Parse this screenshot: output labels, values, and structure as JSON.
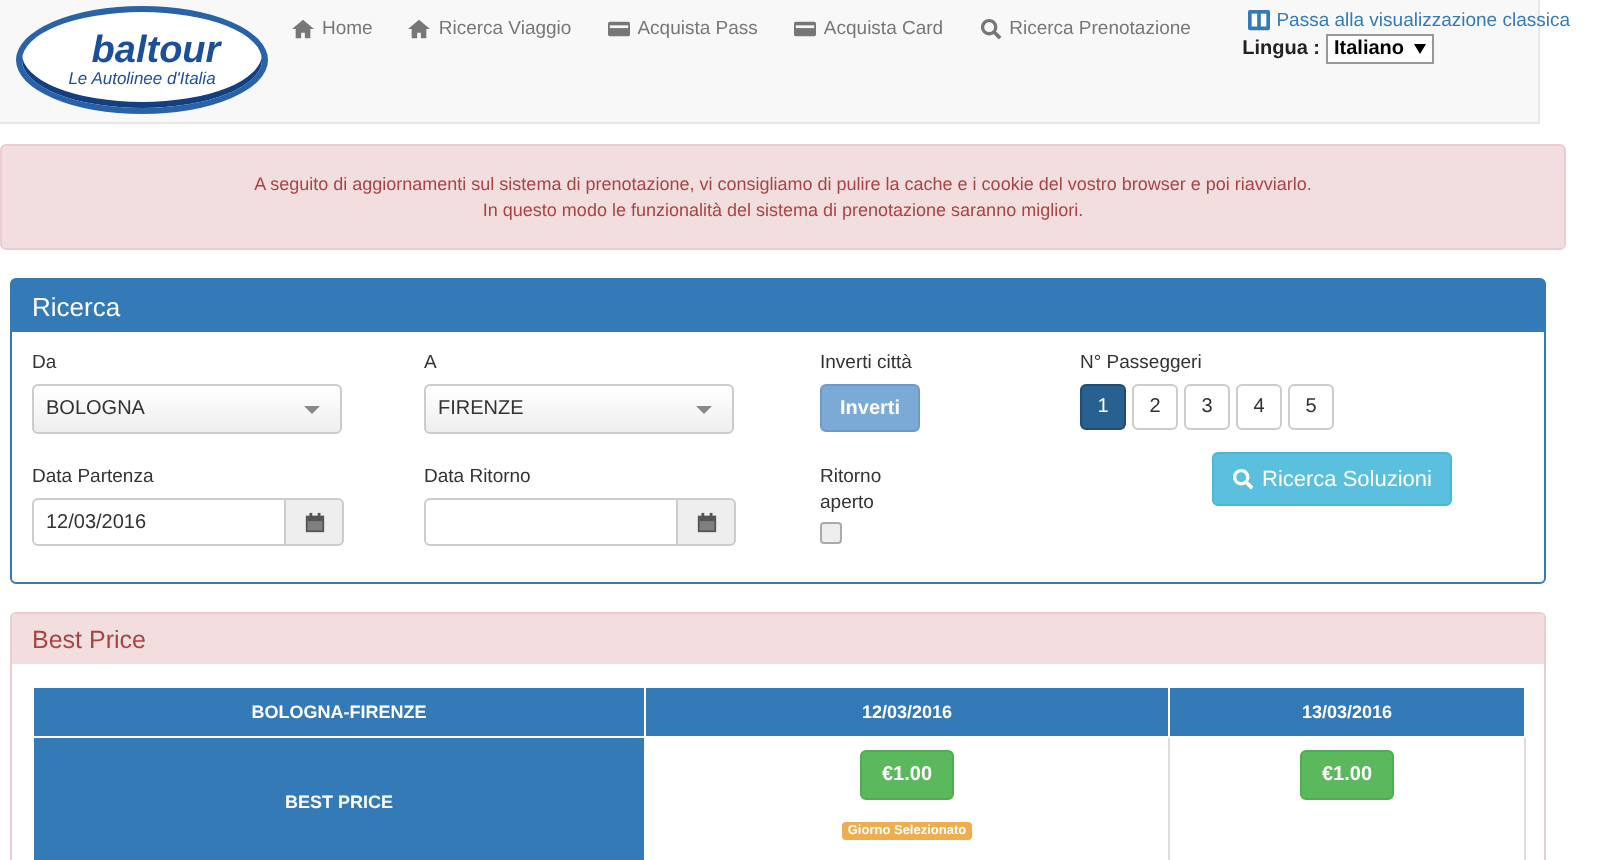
{
  "header": {
    "logo": {
      "name": "baltour",
      "tagline": "Le Autolinee d'Italia"
    },
    "nav": [
      {
        "label": "Home",
        "kind": "home"
      },
      {
        "label": "Ricerca Viaggio",
        "kind": "home"
      },
      {
        "label": "Acquista Pass",
        "kind": "card"
      },
      {
        "label": "Acquista Card",
        "kind": "card"
      },
      {
        "label": "Ricerca Prenotazione",
        "kind": "search"
      }
    ],
    "classic_link": "Passa alla visualizzazione classica",
    "language": {
      "label": "Lingua :",
      "value": "Italiano"
    }
  },
  "alert": {
    "lines": [
      "A seguito di aggiornamenti sul sistema di prenotazione, vi consigliamo di pulire la cache e i cookie del vostro browser e poi riavviarlo.",
      "In questo modo le funzionalità del sistema di prenotazione saranno migliori."
    ]
  },
  "search": {
    "title": "Ricerca",
    "from": {
      "label": "Da",
      "value": "BOLOGNA"
    },
    "to": {
      "label": "A",
      "value": "FIRENZE"
    },
    "swap": {
      "label": "Inverti città",
      "button": "Inverti"
    },
    "passengers": {
      "label": "N° Passeggeri",
      "options": [
        {
          "label": "1",
          "selected": true
        },
        {
          "label": "2",
          "selected": false
        },
        {
          "label": "3",
          "selected": false
        },
        {
          "label": "4",
          "selected": false
        },
        {
          "label": "5",
          "selected": false
        }
      ]
    },
    "departure": {
      "label": "Data Partenza",
      "value": "12/03/2016"
    },
    "return": {
      "label": "Data Ritorno"
    },
    "open_return": {
      "label": "Ritorno aperto",
      "checked": false
    },
    "submit": "Ricerca Soluzioni"
  },
  "best_price": {
    "title": "Best Price",
    "route": "BOLOGNA-FIRENZE",
    "row_label": "BEST PRICE",
    "days": [
      {
        "date": "12/03/2016",
        "price": "€1.00",
        "badge": "Giorno Selezionato"
      },
      {
        "date": "13/03/2016",
        "price": "€1.00"
      }
    ]
  }
}
